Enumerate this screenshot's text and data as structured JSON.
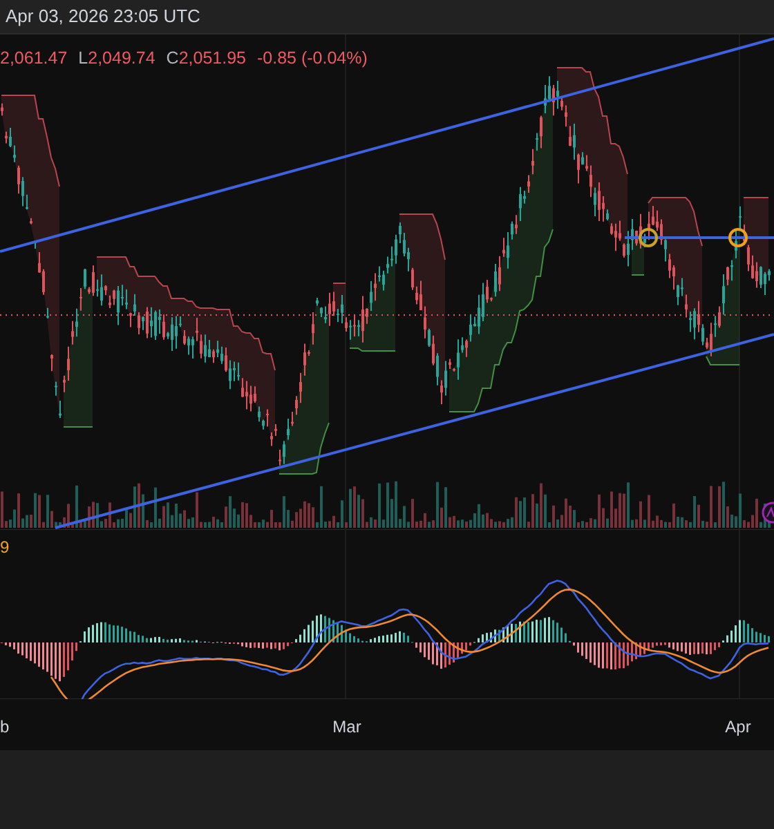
{
  "header": {
    "timestamp": "Apr 03, 2026 23:05 UTC"
  },
  "legend": {
    "items": [
      {
        "value": "2,061.47"
      },
      {
        "label": "L",
        "value": "2,049.74"
      },
      {
        "label": "C",
        "value": "2,051.95"
      },
      {
        "value": "-0.85 (-0.04%)"
      }
    ]
  },
  "macd_legend": {
    "value": "9"
  },
  "time_axis": {
    "labels": [
      "b",
      "Mar",
      "Apr"
    ]
  }
}
